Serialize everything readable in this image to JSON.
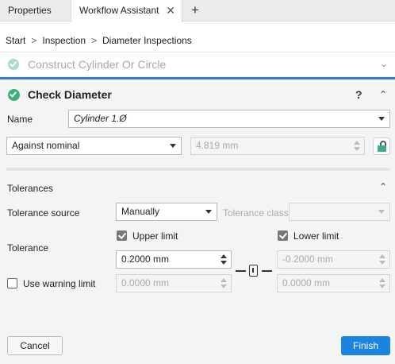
{
  "tabs": [
    {
      "label": "Properties"
    },
    {
      "label": "Workflow Assistant",
      "close_glyph": "✕"
    }
  ],
  "add_tab_glyph": "+",
  "breadcrumb": {
    "items": [
      "Start",
      "Inspection",
      "Diameter Inspections"
    ],
    "separator": ">"
  },
  "previous_step": {
    "label": "Construct Cylinder Or Circle",
    "chevron": "⌄"
  },
  "section": {
    "title": "Check Diameter",
    "help": "?",
    "collapse": "^"
  },
  "name": {
    "label": "Name",
    "value": "Cylinder 1.Ø"
  },
  "check_type": {
    "value": "Against nominal"
  },
  "nominal": {
    "value": "4.819 mm"
  },
  "tolerances": {
    "title": "Tolerances",
    "collapse": "^",
    "source_label": "Tolerance source",
    "source_value": "Manually",
    "class_label": "Tolerance class",
    "class_value": "",
    "tolerance_label": "Tolerance",
    "upper_label": "Upper limit",
    "upper_checked": true,
    "upper_value": "0.2000 mm",
    "lower_label": "Lower limit",
    "lower_checked": true,
    "lower_value": "-0.2000 mm",
    "warning_label": "Use warning limit",
    "warning_checked": false,
    "warning_upper_value": "0.0000 mm",
    "warning_lower_value": "0.0000 mm"
  },
  "buttons": {
    "cancel": "Cancel",
    "finish": "Finish"
  },
  "colors": {
    "accent": "#1a84e0",
    "success": "#3bb07e",
    "progress": "#2d7dd2"
  }
}
